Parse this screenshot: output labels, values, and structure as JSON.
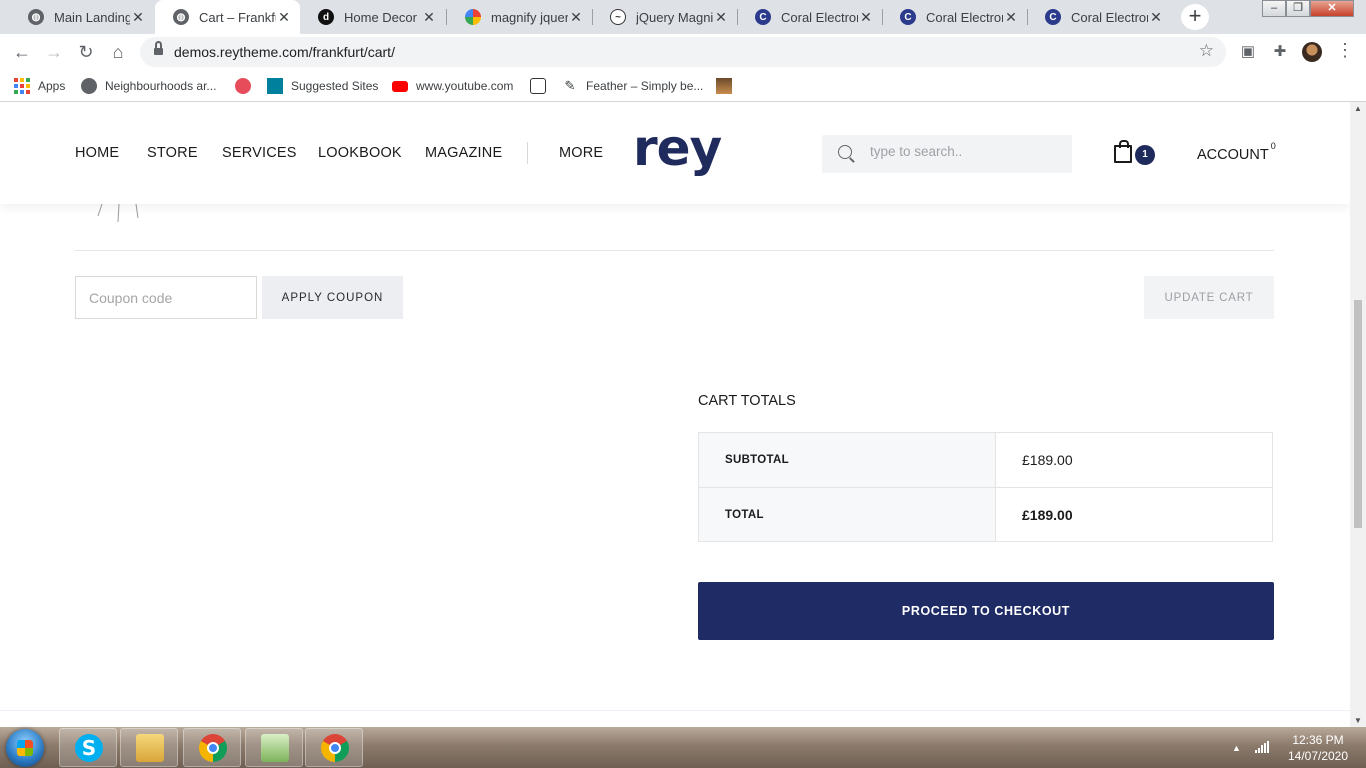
{
  "browser": {
    "tabs": [
      {
        "title": "Main Landing P",
        "icon": "globe-icon",
        "active": false
      },
      {
        "title": "Cart – Frankfurt",
        "icon": "globe-icon",
        "active": true
      },
      {
        "title": "Home Decor",
        "icon": "site-icon",
        "active": false
      },
      {
        "title": "magnify jquery",
        "icon": "google-icon",
        "active": false
      },
      {
        "title": "jQuery Magnifi",
        "icon": "jquery-icon",
        "active": false
      },
      {
        "title": "Coral Electronic",
        "icon": "coral-icon",
        "active": false
      },
      {
        "title": "Coral Electronic",
        "icon": "coral-icon",
        "active": false
      },
      {
        "title": "Coral Electronic",
        "icon": "coral-icon",
        "active": false
      }
    ],
    "url": "demos.reytheme.com/frankfurt/cart/",
    "bookmarks": [
      {
        "label": "Apps",
        "icon": "apps-grid-icon"
      },
      {
        "label": "Neighbourhoods ar...",
        "icon": "globe-icon"
      },
      {
        "label": "",
        "icon": "pinwheel-icon"
      },
      {
        "label": "Suggested Sites",
        "icon": "bing-icon"
      },
      {
        "label": "www.youtube.com",
        "icon": "youtube-icon"
      },
      {
        "label": "",
        "icon": "figure-icon"
      },
      {
        "label": "Feather – Simply be...",
        "icon": "feather-icon"
      },
      {
        "label": "",
        "icon": "thumbnail-icon"
      }
    ]
  },
  "site": {
    "menu": {
      "home": "HOME",
      "store": "STORE",
      "services": "SERVICES",
      "lookbook": "LOOKBOOK",
      "magazine": "MAGAZINE",
      "more": "MORE"
    },
    "logo": "rey",
    "search_placeholder": "type to search..",
    "cart_count": "1",
    "account_label": "ACCOUNT",
    "account_count": "0"
  },
  "cart": {
    "coupon_placeholder": "Coupon code",
    "apply_coupon": "APPLY COUPON",
    "update_cart": "UPDATE CART",
    "totals_heading": "CART TOTALS",
    "rows": [
      {
        "label": "SUBTOTAL",
        "value": "£189.00"
      },
      {
        "label": "TOTAL",
        "value": "£189.00"
      }
    ],
    "checkout_label": "PROCEED TO CHECKOUT"
  },
  "taskbar": {
    "apps": [
      "skype-icon",
      "explorer-icon",
      "chrome-icon",
      "editor-icon",
      "chrome-icon"
    ],
    "time": "12:36 PM",
    "date": "14/07/2020"
  },
  "colors": {
    "brand_navy": "#1f2b65",
    "logo": "#1f2b5c",
    "button_gray": "#eceef1"
  }
}
